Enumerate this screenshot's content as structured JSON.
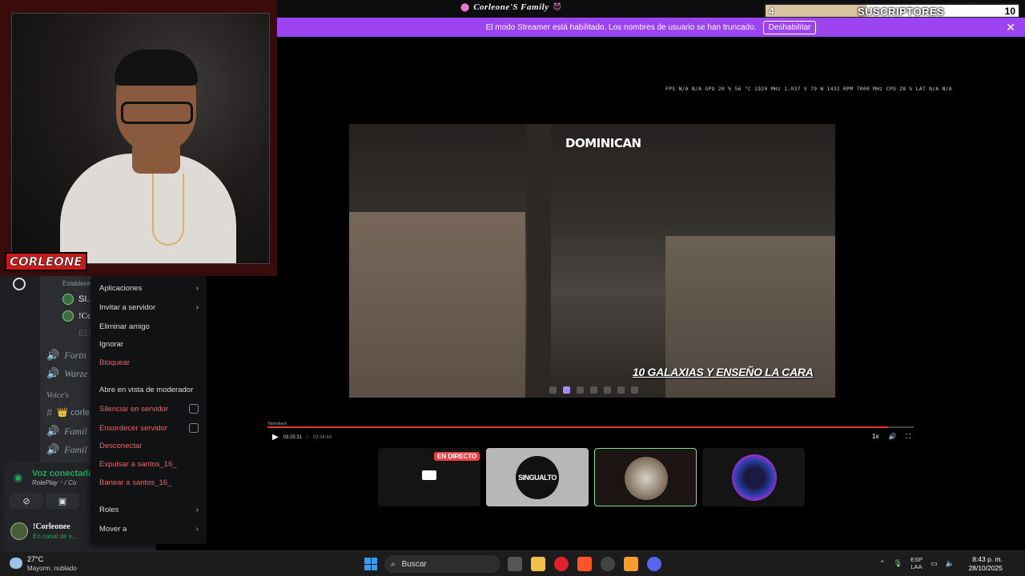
{
  "window": {
    "title": "Corleone'S Family",
    "title_emoji_left": "⬤",
    "title_emoji_right": "😈"
  },
  "subs_overlay": {
    "current": "4",
    "label": "SUSCRIPTORES",
    "goal": "10",
    "progress_fraction": 0.4
  },
  "banner": {
    "text": "El modo Streamer está habilitado. Los nombres de usuario se han truncado.",
    "button": "Deshabilitar",
    "close": "✕"
  },
  "webcam": {
    "overlay_logo": "CORLEONE"
  },
  "channels": {
    "items": [
      {
        "text": "Establece",
        "kind": "sub"
      },
      {
        "text": "SI...",
        "kind": "user"
      },
      {
        "text": "!Co",
        "kind": "user"
      },
      {
        "text": "ELR",
        "kind": "user"
      },
      {
        "text": "Fortn",
        "kind": "voice"
      },
      {
        "text": "Warze",
        "kind": "voice"
      },
      {
        "text": "Voice's",
        "kind": "category"
      },
      {
        "text": "👑 corle",
        "kind": "text"
      },
      {
        "text": "Famil",
        "kind": "voice"
      },
      {
        "text": "Famil",
        "kind": "voice"
      }
    ]
  },
  "voice_panel": {
    "status": "Voz conectada",
    "channel": "RolePlay ⁺ / Co",
    "user_name": "!Corleonee",
    "user_sub": "En canal de v..."
  },
  "context_menu": {
    "items": [
      {
        "label": "Aplicaciones",
        "type": "submenu",
        "style": "normal"
      },
      {
        "label": "Invitar a servidor",
        "type": "submenu",
        "style": "normal"
      },
      {
        "label": "Eliminar amigo",
        "type": "action",
        "style": "normal"
      },
      {
        "label": "Ignorar",
        "type": "action",
        "style": "normal"
      },
      {
        "label": "Bloquear",
        "type": "action",
        "style": "danger"
      },
      {
        "label": "Abre en vista de moderador",
        "type": "action",
        "style": "normal"
      },
      {
        "label": "Silenciar en servidor",
        "type": "checkbox",
        "style": "danger"
      },
      {
        "label": "Ensordecer servidor",
        "type": "checkbox",
        "style": "danger"
      },
      {
        "label": "Desconectar",
        "type": "action",
        "style": "danger"
      },
      {
        "label": "Expulsar a santos_16_",
        "type": "action",
        "style": "danger"
      },
      {
        "label": "Banear a santos_16_",
        "type": "action",
        "style": "danger"
      },
      {
        "label": "Roles",
        "type": "submenu",
        "style": "normal"
      },
      {
        "label": "Mover a",
        "type": "submenu",
        "style": "normal"
      }
    ]
  },
  "stream": {
    "stats": "FPS N/A N/A   GPU 20 % 56 °C 1920 MHz 1.037 V 79 W 1432 RPM 7000 MHz   CPU 28 %   LAT N/A N/A",
    "game_logo": "DOMINICAN",
    "caption": "10 GALAXIAS Y ENSEÑO LA CARA",
    "topmark": "Topnoback",
    "time_current": "03:25:31",
    "time_total": "03:34:44",
    "progress_fraction": 0.96,
    "speed": "1x"
  },
  "thumbnails": [
    {
      "kind": "screen",
      "badge": "EN DIRECTO"
    },
    {
      "kind": "logo",
      "text": "SINGUALTO"
    },
    {
      "kind": "portrait"
    },
    {
      "kind": "orb"
    }
  ],
  "taskbar": {
    "weather_temp": "27°C",
    "weather_desc": "Mayorm. nublado",
    "search": "Buscar",
    "lang_top": "ESP",
    "lang_bottom": "LAA",
    "time": "8:43 p. m.",
    "date": "28/10/2025"
  }
}
